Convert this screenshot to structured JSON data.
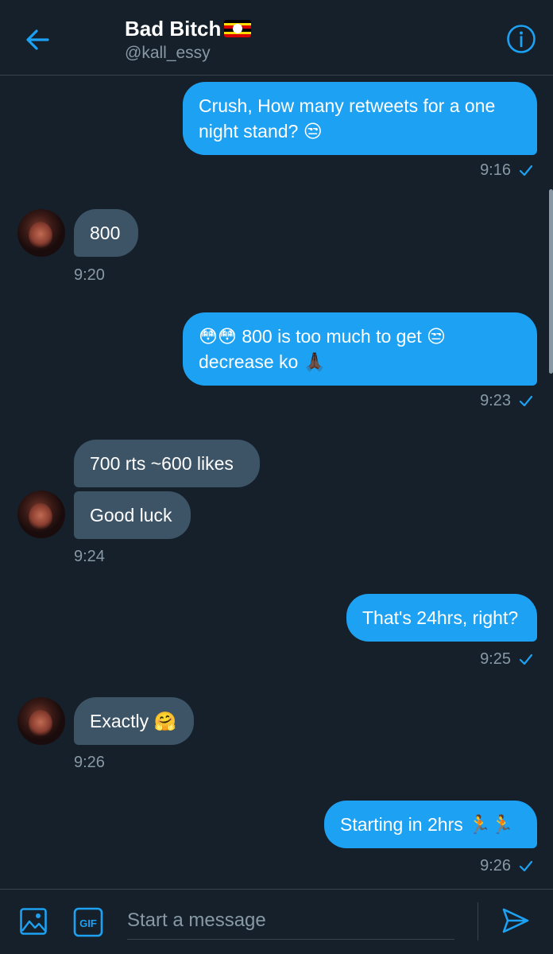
{
  "header": {
    "title": "Bad Bitch",
    "handle": "@kall_essy",
    "back_icon": "arrow-left-icon",
    "info_icon": "info-icon",
    "accent": "#1da1f2"
  },
  "messages": [
    {
      "dir": "out",
      "text": "Crush, How many retweets for a one night stand? 😒",
      "time": "9:16"
    },
    {
      "dir": "in",
      "text": "800",
      "time": "9:20"
    },
    {
      "dir": "out",
      "text": "😳😳 800 is too much to get 😒 decrease ko 🙏🏿",
      "time": "9:23"
    },
    {
      "dir": "in",
      "text": "700 rts ~600 likes"
    },
    {
      "dir": "in",
      "text": "Good luck",
      "time": "9:24"
    },
    {
      "dir": "out",
      "text": "That's 24hrs, right?",
      "time": "9:25"
    },
    {
      "dir": "in",
      "text": "Exactly 🤗",
      "time": "9:26"
    },
    {
      "dir": "out",
      "text": "Starting in 2hrs 🏃🏃",
      "time": "9:26"
    }
  ],
  "composer": {
    "placeholder": "Start a message",
    "gif_label": "GIF"
  },
  "colors": {
    "background": "#15202b",
    "outgoing_bubble": "#1da1f2",
    "incoming_bubble": "#3d5466",
    "muted_text": "#8899a6"
  }
}
